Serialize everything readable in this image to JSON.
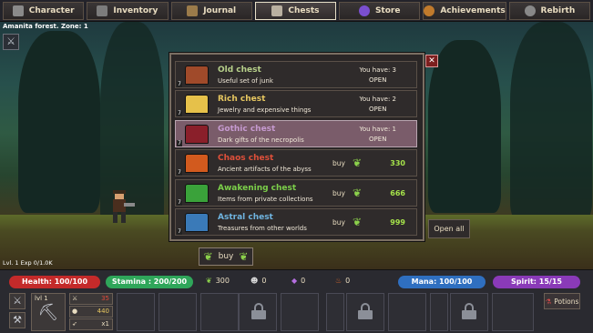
{
  "nav": {
    "tabs": [
      {
        "label": "Character",
        "icon": "character-icon",
        "color": "#8a8a8a"
      },
      {
        "label": "Inventory",
        "icon": "inventory-icon",
        "color": "#7c7c7c"
      },
      {
        "label": "Journal",
        "icon": "journal-icon",
        "color": "#9b7b4a"
      },
      {
        "label": "Chests",
        "icon": "chest-icon",
        "color": "#b9b0a0",
        "active": true
      },
      {
        "label": "Store",
        "icon": "store-icon",
        "color": "#7a4fd0"
      },
      {
        "label": "Achievements",
        "icon": "achievements-icon",
        "color": "#c07a2c"
      },
      {
        "label": "Rebirth",
        "icon": "rebirth-icon",
        "color": "#888"
      }
    ]
  },
  "zone": "Amanita forest. Zone: 1",
  "level_line": "Lvl. 1 Exp 0/1.0K",
  "chests": [
    {
      "num": "7",
      "name": "Old chest",
      "desc": "Useful set of junk",
      "name_color": "#b7d08a",
      "chest_color": "#a04a2a",
      "have": "You have: 3",
      "action": "OPEN"
    },
    {
      "num": "7",
      "name": "Rich chest",
      "desc": "Jewelry and expensive things",
      "name_color": "#e8c860",
      "chest_color": "#e6c14a",
      "have": "You have: 2",
      "action": "OPEN"
    },
    {
      "num": "7",
      "name": "Gothic chest",
      "desc": "Dark gifts of the necropolis",
      "name_color": "#c69ad0",
      "chest_color": "#8a1f2a",
      "have": "You have: 1",
      "action": "OPEN",
      "selected": true
    },
    {
      "num": "7",
      "name": "Chaos chest",
      "desc": "Ancient artifacts of the abyss",
      "name_color": "#e0503a",
      "chest_color": "#d25a1e",
      "buy": "buy",
      "price": "330"
    },
    {
      "num": "7",
      "name": "Awakening chest",
      "desc": "Items from private collections",
      "name_color": "#7cd04a",
      "chest_color": "#3aa23a",
      "buy": "buy",
      "price": "666"
    },
    {
      "num": "7",
      "name": "Astral chest",
      "desc": "Treasures from other worlds",
      "name_color": "#6fb4e0",
      "chest_color": "#3a7ab8",
      "buy": "buy",
      "price": "999"
    }
  ],
  "open_all": "Open all",
  "buy_button": "buy",
  "stats": {
    "health": {
      "label": "Health: 100/100",
      "color": "#c42a2a"
    },
    "stamina": {
      "label": "Stamina : 200/200",
      "color": "#2fa65a"
    },
    "mana": {
      "label": "Mana: 100/100",
      "color": "#2f6fc0"
    },
    "spirit": {
      "label": "Spirit: 15/15",
      "color": "#8a3ab8"
    }
  },
  "resources": [
    {
      "value": "300",
      "icon": "leaf-icon"
    },
    {
      "value": "0",
      "icon": "skull-icon"
    },
    {
      "value": "0",
      "icon": "crystal-icon"
    },
    {
      "value": "0",
      "icon": "flame-icon"
    }
  ],
  "equipment": {
    "item_level": "lvl 1",
    "mini": [
      {
        "icon": "sword-icon",
        "value": "35"
      },
      {
        "icon": "gold-icon",
        "value": "440"
      },
      {
        "icon": "arrow-icon",
        "value": "x1"
      }
    ]
  },
  "potions": "Potions"
}
